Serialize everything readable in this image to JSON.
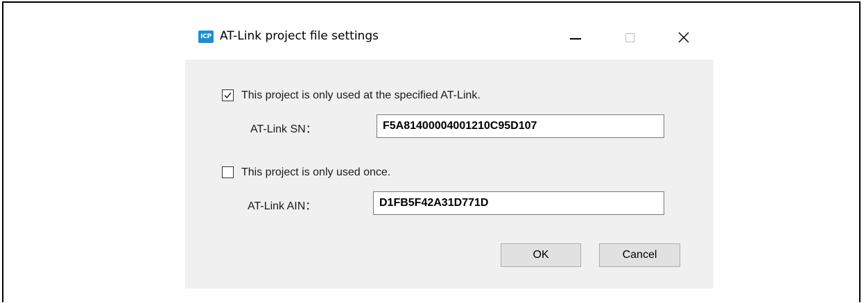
{
  "window": {
    "title": "AT-Link project file settings",
    "app_icon_text": "ICP",
    "app_icon_name": "icp-app-icon",
    "minimize_icon": "minimize-icon",
    "maximize_icon": "maximize-icon",
    "close_icon": "close-icon",
    "close_glyph": "✕"
  },
  "options": {
    "specified_atlink": {
      "label": "This project is only used at the specified AT-Link.",
      "checked": true
    },
    "used_once": {
      "label": "This project is only used once.",
      "checked": false
    }
  },
  "fields": {
    "sn": {
      "label": "AT-Link SN：",
      "value": "F5A81400004001210C95D107"
    },
    "ain": {
      "label": "AT-Link AIN：",
      "value": "D1FB5F42A31D771D"
    }
  },
  "buttons": {
    "ok": "OK",
    "cancel": "Cancel"
  },
  "colors": {
    "dialog_bg": "#f0f0f0",
    "titlebar_bg": "#ffffff",
    "app_icon_bg": "#1a8fd6",
    "button_bg": "#e1e1e1"
  }
}
